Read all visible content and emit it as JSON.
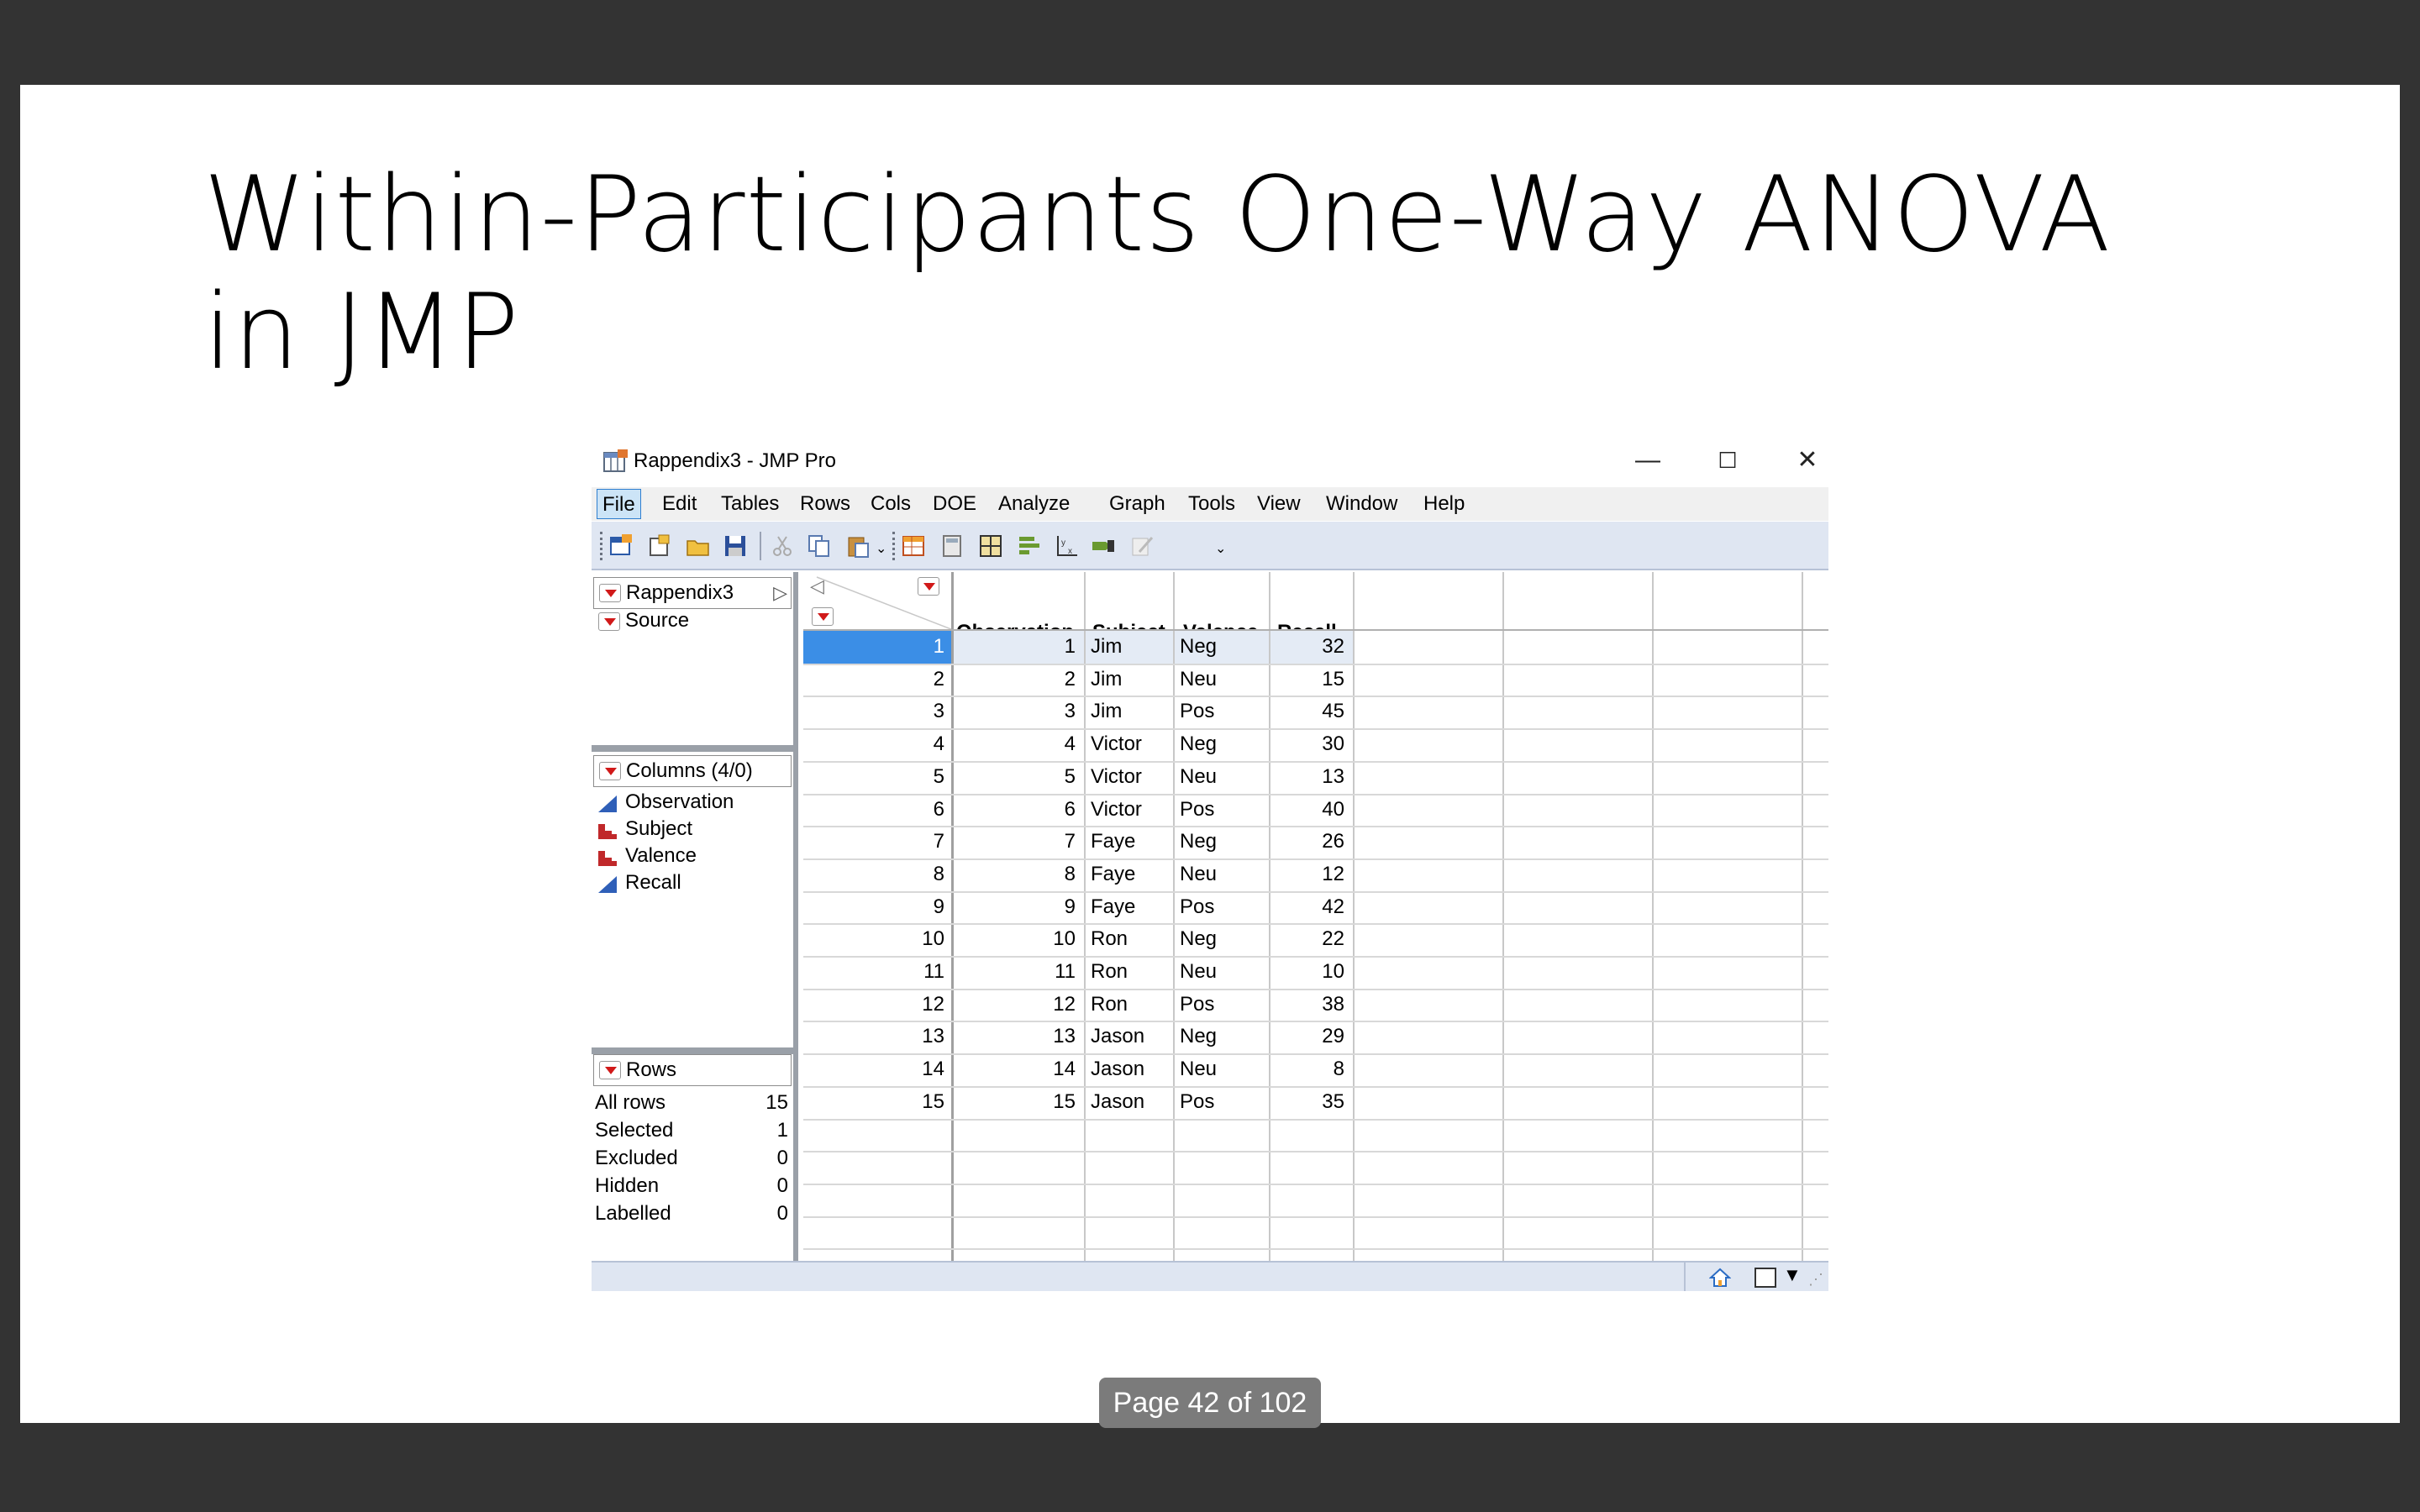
{
  "slide": {
    "title": "Within-Participants One-Way ANOVA\nin JMP"
  },
  "window": {
    "title": "Rappendix3 - JMP Pro",
    "controls": {
      "minimize": "—",
      "maximize": "☐",
      "close": "✕"
    }
  },
  "menubar": [
    "File",
    "Edit",
    "Tables",
    "Rows",
    "Cols",
    "DOE",
    "Analyze",
    "Graph",
    "Tools",
    "View",
    "Window",
    "Help"
  ],
  "left_panel": {
    "table_name": "Rappendix3",
    "source_label": "Source",
    "columns_header": "Columns (4/0)",
    "columns": [
      {
        "name": "Observation",
        "type": "continuous"
      },
      {
        "name": "Subject",
        "type": "nominal"
      },
      {
        "name": "Valence",
        "type": "nominal"
      },
      {
        "name": "Recall",
        "type": "continuous"
      }
    ],
    "rows_header": "Rows",
    "row_stats": [
      {
        "label": "All rows",
        "value": "15"
      },
      {
        "label": "Selected",
        "value": "1"
      },
      {
        "label": "Excluded",
        "value": "0"
      },
      {
        "label": "Hidden",
        "value": "0"
      },
      {
        "label": "Labelled",
        "value": "0"
      }
    ]
  },
  "table": {
    "headers": [
      "Observation",
      "Subject",
      "Valence",
      "Recall"
    ],
    "rows": [
      [
        "1",
        "1",
        "Jim",
        "Neg",
        "32"
      ],
      [
        "2",
        "2",
        "Jim",
        "Neu",
        "15"
      ],
      [
        "3",
        "3",
        "Jim",
        "Pos",
        "45"
      ],
      [
        "4",
        "4",
        "Victor",
        "Neg",
        "30"
      ],
      [
        "5",
        "5",
        "Victor",
        "Neu",
        "13"
      ],
      [
        "6",
        "6",
        "Victor",
        "Pos",
        "40"
      ],
      [
        "7",
        "7",
        "Faye",
        "Neg",
        "26"
      ],
      [
        "8",
        "8",
        "Faye",
        "Neu",
        "12"
      ],
      [
        "9",
        "9",
        "Faye",
        "Pos",
        "42"
      ],
      [
        "10",
        "10",
        "Ron",
        "Neg",
        "22"
      ],
      [
        "11",
        "11",
        "Ron",
        "Neu",
        "10"
      ],
      [
        "12",
        "12",
        "Ron",
        "Pos",
        "38"
      ],
      [
        "13",
        "13",
        "Jason",
        "Neg",
        "29"
      ],
      [
        "14",
        "14",
        "Jason",
        "Neu",
        "8"
      ],
      [
        "15",
        "15",
        "Jason",
        "Pos",
        "35"
      ]
    ],
    "selected_row": 1
  },
  "pager": {
    "label": "Page 42 of 102"
  },
  "colors": {
    "selected_row": "#3b8ee6",
    "toolbar": "#dfe6f2",
    "menu_active": "#cce4f7",
    "red_triangle": "#d11919"
  }
}
